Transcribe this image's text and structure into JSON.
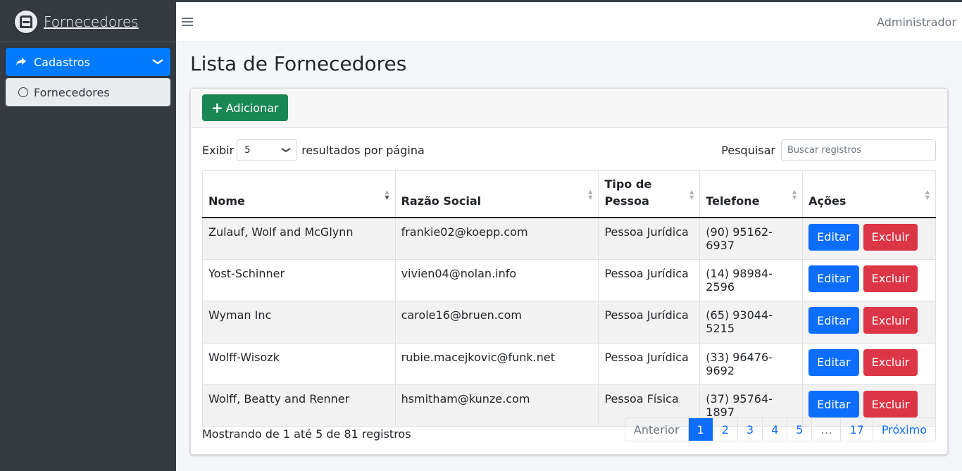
{
  "brand": {
    "title": "Fornecedores"
  },
  "sidebar": {
    "items": [
      {
        "label": "Cadastros",
        "icon": "share-arrow-icon"
      },
      {
        "label": "Fornecedores",
        "icon": "circle-icon"
      }
    ]
  },
  "header": {
    "user": "Administrador"
  },
  "page": {
    "title": "Lista de Fornecedores"
  },
  "toolbar": {
    "add_label": "Adicionar"
  },
  "controls": {
    "show_label": "Exibir",
    "page_size": "5",
    "per_page_label": "resultados por página",
    "search_label": "Pesquisar",
    "search_placeholder": "Buscar registros"
  },
  "table": {
    "headers": [
      "Nome",
      "Razão Social",
      "Tipo de Pessoa",
      "Telefone",
      "Ações"
    ],
    "rows": [
      {
        "nome": "Zulauf, Wolf and McGlynn",
        "razao": "frankie02@koepp.com",
        "tipo": "Pessoa Jurídica",
        "telefone": "(90) 95162-6937"
      },
      {
        "nome": "Yost-Schinner",
        "razao": "vivien04@nolan.info",
        "tipo": "Pessoa Jurídica",
        "telefone": "(14) 98984-2596"
      },
      {
        "nome": "Wyman Inc",
        "razao": "carole16@bruen.com",
        "tipo": "Pessoa Jurídica",
        "telefone": "(65) 93044-5215"
      },
      {
        "nome": "Wolff-Wisozk",
        "razao": "rubie.macejkovic@funk.net",
        "tipo": "Pessoa Jurídica",
        "telefone": "(33) 96476-9692"
      },
      {
        "nome": "Wolff, Beatty and Renner",
        "razao": "hsmitham@kunze.com",
        "tipo": "Pessoa Física",
        "telefone": "(37) 95764-1897"
      }
    ],
    "edit_label": "Editar",
    "delete_label": "Excluir"
  },
  "footer": {
    "info": "Mostrando de 1 até 5 de 81 registros",
    "pagination": [
      "Anterior",
      "1",
      "2",
      "3",
      "4",
      "5",
      "…",
      "17",
      "Próximo"
    ]
  },
  "colors": {
    "primary": "#0d6efd",
    "success": "#198754",
    "danger": "#dc3545",
    "sidebar": "#343a40"
  }
}
